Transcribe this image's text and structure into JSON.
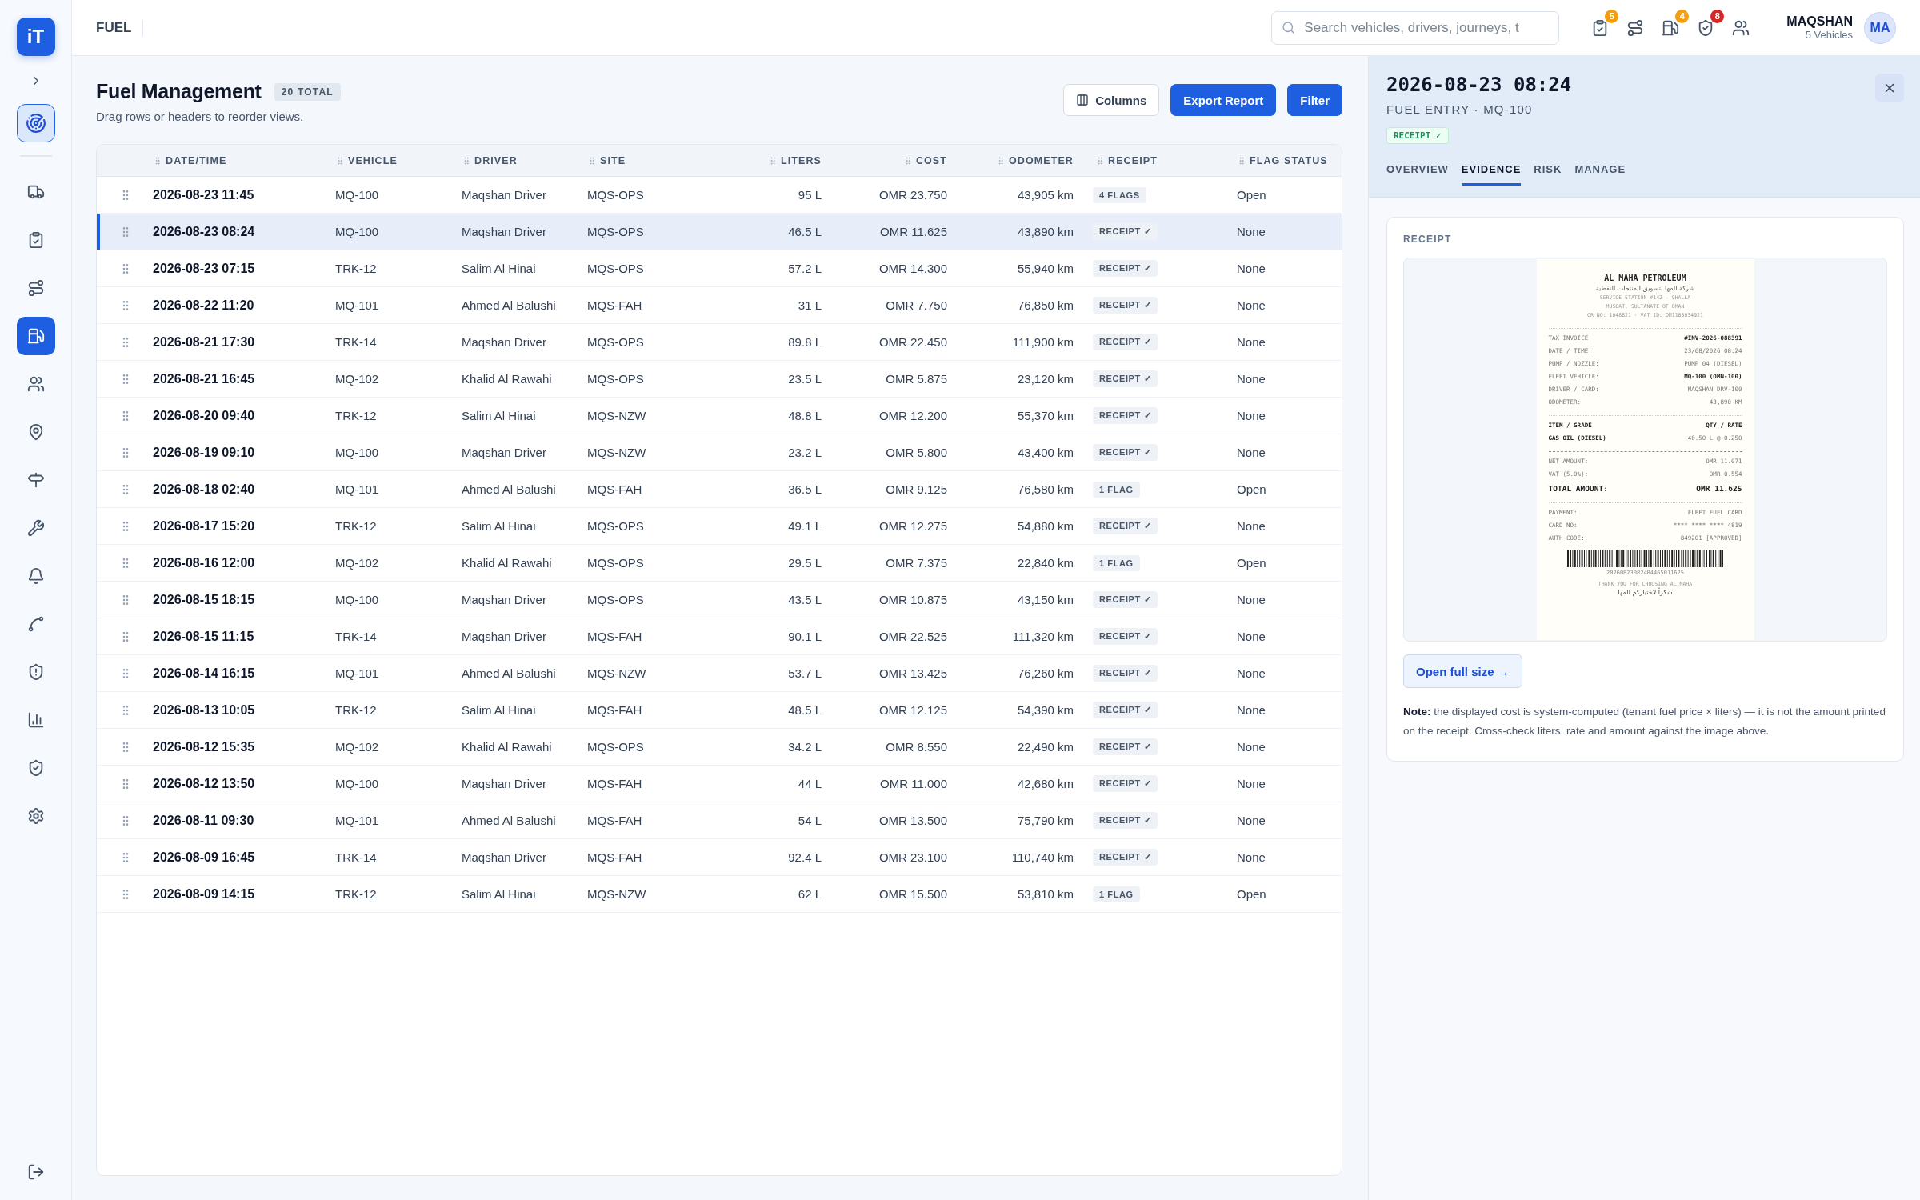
{
  "logo": "iT",
  "sidebar": {
    "home": {
      "selected": true
    },
    "items": [
      {
        "selected": false
      },
      {
        "selected": false
      },
      {
        "selected": false
      },
      {
        "selected": true
      },
      {
        "selected": false
      },
      {
        "selected": false
      },
      {
        "selected": false
      },
      {
        "selected": false
      },
      {
        "selected": false
      },
      {
        "selected": false
      },
      {
        "selected": false
      },
      {
        "selected": false
      },
      {
        "selected": false
      },
      {
        "selected": false
      }
    ]
  },
  "topbar": {
    "section": "FUEL",
    "search": {
      "placeholder": "Search vehicles, drivers, journeys, t"
    },
    "icons": [
      {
        "has_badge": true,
        "badge": "5",
        "color": "#f59e0b"
      },
      {
        "has_badge": false
      },
      {
        "has_badge": true,
        "badge": "4",
        "color": "#f59e0b"
      },
      {
        "has_badge": true,
        "badge": "8",
        "color": "#dc2626"
      },
      {
        "has_badge": false
      }
    ],
    "user": {
      "name": "MAQSHAN",
      "detail": "5 Vehicles",
      "initials": "MA"
    }
  },
  "page": {
    "title": "Fuel Management",
    "count": "20 TOTAL",
    "subtitle": "Drag rows or headers to reorder views.",
    "buttons": [
      {
        "label": "Columns",
        "kind": "secondary"
      },
      {
        "label": "Export Report",
        "kind": "primary"
      },
      {
        "label": "Filter",
        "kind": "primary"
      }
    ]
  },
  "table": {
    "columns": [
      "DATE/TIME",
      "VEHICLE",
      "DRIVER",
      "SITE",
      "LITERS",
      "COST",
      "ODOMETER",
      "RECEIPT",
      "FLAG STATUS"
    ],
    "rows": [
      {
        "selected": false,
        "cells": [
          "2026-08-23 11:45",
          "MQ-100",
          "Maqshan Driver",
          "MQS-OPS",
          "95 L",
          "OMR 23.750",
          "43,905 km",
          "4 FLAGS",
          "Open"
        ]
      },
      {
        "selected": true,
        "cells": [
          "2026-08-23 08:24",
          "MQ-100",
          "Maqshan Driver",
          "MQS-OPS",
          "46.5 L",
          "OMR 11.625",
          "43,890 km",
          "RECEIPT ✓",
          "None"
        ]
      },
      {
        "selected": false,
        "cells": [
          "2026-08-23 07:15",
          "TRK-12",
          "Salim Al Hinai",
          "MQS-OPS",
          "57.2 L",
          "OMR 14.300",
          "55,940 km",
          "RECEIPT ✓",
          "None"
        ]
      },
      {
        "selected": false,
        "cells": [
          "2026-08-22 11:20",
          "MQ-101",
          "Ahmed Al Balushi",
          "MQS-FAH",
          "31 L",
          "OMR 7.750",
          "76,850 km",
          "RECEIPT ✓",
          "None"
        ]
      },
      {
        "selected": false,
        "cells": [
          "2026-08-21 17:30",
          "TRK-14",
          "Maqshan Driver",
          "MQS-OPS",
          "89.8 L",
          "OMR 22.450",
          "111,900 km",
          "RECEIPT ✓",
          "None"
        ]
      },
      {
        "selected": false,
        "cells": [
          "2026-08-21 16:45",
          "MQ-102",
          "Khalid Al Rawahi",
          "MQS-OPS",
          "23.5 L",
          "OMR 5.875",
          "23,120 km",
          "RECEIPT ✓",
          "None"
        ]
      },
      {
        "selected": false,
        "cells": [
          "2026-08-20 09:40",
          "TRK-12",
          "Salim Al Hinai",
          "MQS-NZW",
          "48.8 L",
          "OMR 12.200",
          "55,370 km",
          "RECEIPT ✓",
          "None"
        ]
      },
      {
        "selected": false,
        "cells": [
          "2026-08-19 09:10",
          "MQ-100",
          "Maqshan Driver",
          "MQS-NZW",
          "23.2 L",
          "OMR 5.800",
          "43,400 km",
          "RECEIPT ✓",
          "None"
        ]
      },
      {
        "selected": false,
        "cells": [
          "2026-08-18 02:40",
          "MQ-101",
          "Ahmed Al Balushi",
          "MQS-FAH",
          "36.5 L",
          "OMR 9.125",
          "76,580 km",
          "1 FLAG",
          "Open"
        ]
      },
      {
        "selected": false,
        "cells": [
          "2026-08-17 15:20",
          "TRK-12",
          "Salim Al Hinai",
          "MQS-OPS",
          "49.1 L",
          "OMR 12.275",
          "54,880 km",
          "RECEIPT ✓",
          "None"
        ]
      },
      {
        "selected": false,
        "cells": [
          "2026-08-16 12:00",
          "MQ-102",
          "Khalid Al Rawahi",
          "MQS-OPS",
          "29.5 L",
          "OMR 7.375",
          "22,840 km",
          "1 FLAG",
          "Open"
        ]
      },
      {
        "selected": false,
        "cells": [
          "2026-08-15 18:15",
          "MQ-100",
          "Maqshan Driver",
          "MQS-OPS",
          "43.5 L",
          "OMR 10.875",
          "43,150 km",
          "RECEIPT ✓",
          "None"
        ]
      },
      {
        "selected": false,
        "cells": [
          "2026-08-15 11:15",
          "TRK-14",
          "Maqshan Driver",
          "MQS-FAH",
          "90.1 L",
          "OMR 22.525",
          "111,320 km",
          "RECEIPT ✓",
          "None"
        ]
      },
      {
        "selected": false,
        "cells": [
          "2026-08-14 16:15",
          "MQ-101",
          "Ahmed Al Balushi",
          "MQS-NZW",
          "53.7 L",
          "OMR 13.425",
          "76,260 km",
          "RECEIPT ✓",
          "None"
        ]
      },
      {
        "selected": false,
        "cells": [
          "2026-08-13 10:05",
          "TRK-12",
          "Salim Al Hinai",
          "MQS-FAH",
          "48.5 L",
          "OMR 12.125",
          "54,390 km",
          "RECEIPT ✓",
          "None"
        ]
      },
      {
        "selected": false,
        "cells": [
          "2026-08-12 15:35",
          "MQ-102",
          "Khalid Al Rawahi",
          "MQS-OPS",
          "34.2 L",
          "OMR 8.550",
          "22,490 km",
          "RECEIPT ✓",
          "None"
        ]
      },
      {
        "selected": false,
        "cells": [
          "2026-08-12 13:50",
          "MQ-100",
          "Maqshan Driver",
          "MQS-FAH",
          "44 L",
          "OMR 11.000",
          "42,680 km",
          "RECEIPT ✓",
          "None"
        ]
      },
      {
        "selected": false,
        "cells": [
          "2026-08-11 09:30",
          "MQ-101",
          "Ahmed Al Balushi",
          "MQS-FAH",
          "54 L",
          "OMR 13.500",
          "75,790 km",
          "RECEIPT ✓",
          "None"
        ]
      },
      {
        "selected": false,
        "cells": [
          "2026-08-09 16:45",
          "TRK-14",
          "Maqshan Driver",
          "MQS-FAH",
          "92.4 L",
          "OMR 23.100",
          "110,740 km",
          "RECEIPT ✓",
          "None"
        ]
      },
      {
        "selected": false,
        "cells": [
          "2026-08-09 14:15",
          "TRK-12",
          "Salim Al Hinai",
          "MQS-NZW",
          "62 L",
          "OMR 15.500",
          "53,810 km",
          "1 FLAG",
          "Open"
        ]
      }
    ]
  },
  "panel": {
    "title": "2026-08-23 08:24",
    "subtitle": "FUEL ENTRY · MQ-100",
    "badge": "RECEIPT ✓",
    "tabs": [
      {
        "label": "OVERVIEW",
        "selected": false
      },
      {
        "label": "EVIDENCE",
        "selected": true
      },
      {
        "label": "RISK",
        "selected": false
      },
      {
        "label": "MANAGE",
        "selected": false
      }
    ],
    "card_label": "RECEIPT",
    "receipt": {
      "merchant": "AL MAHA PETROLEUM",
      "merchant_arabic": "شركة المها لتسويق المنتجات النفطية",
      "address_lines": [
        "SERVICE STATION #142 - GHALLA",
        "MUSCAT, SULTANATE OF OMAN",
        "CR NO: 1048821 · VAT ID: OM1100034921"
      ],
      "sections": [
        {
          "dashed": false,
          "rows": [
            {
              "label": "TAX INVOICE",
              "value": "#INV-2026-088391",
              "kind": "value_bold"
            },
            {
              "label": "DATE / TIME:",
              "value": "23/08/2026 08:24",
              "kind": "plain"
            },
            {
              "label": "PUMP / NOZZLE:",
              "value": "PUMP 04 (DIESEL)",
              "kind": "plain"
            },
            {
              "label": "FLEET VEHICLE:",
              "value": "MQ-100 (OMN-100)",
              "kind": "value_bold"
            },
            {
              "label": "DRIVER / CARD:",
              "value": "MAQSHAN DRV-100",
              "kind": "plain"
            },
            {
              "label": "ODOMETER:",
              "value": "43,890 KM",
              "kind": "plain"
            }
          ]
        },
        {
          "dashed": false,
          "rows": [
            {
              "label": "ITEM / GRADE",
              "value": "QTY / RATE",
              "kind": "both_bold"
            },
            {
              "label": "GAS OIL (DIESEL)",
              "value": "46.50 L @ 0.250",
              "kind": "label_bold"
            }
          ]
        },
        {
          "dashed": true,
          "rows": [
            {
              "label": "NET AMOUNT:",
              "value": "OMR 11.071",
              "kind": "plain"
            },
            {
              "label": "VAT (5.0%):",
              "value": "OMR 0.554",
              "kind": "plain"
            },
            {
              "label": "TOTAL AMOUNT:",
              "value": "OMR 11.625",
              "kind": "total"
            }
          ]
        },
        {
          "dashed": false,
          "rows": [
            {
              "label": "PAYMENT:",
              "value": "FLEET FUEL CARD",
              "kind": "plain"
            },
            {
              "label": "CARD NO:",
              "value": "**** **** **** 4819",
              "kind": "plain"
            },
            {
              "label": "AUTH CODE:",
              "value": "849201 [APPROVED]",
              "kind": "plain"
            }
          ]
        }
      ],
      "barcode_number": "20260823082404465011625",
      "thank_you": "THANK YOU FOR CHOOSING AL MAHA",
      "thank_you_arabic": "شكراً لاختياركم المها"
    },
    "open_button": "Open full size →",
    "note": "**Note:** the displayed cost is system-computed (tenant fuel price × liters) — it is not the amount printed on the receipt. Cross-check liters, rate and amount against the image above."
  }
}
